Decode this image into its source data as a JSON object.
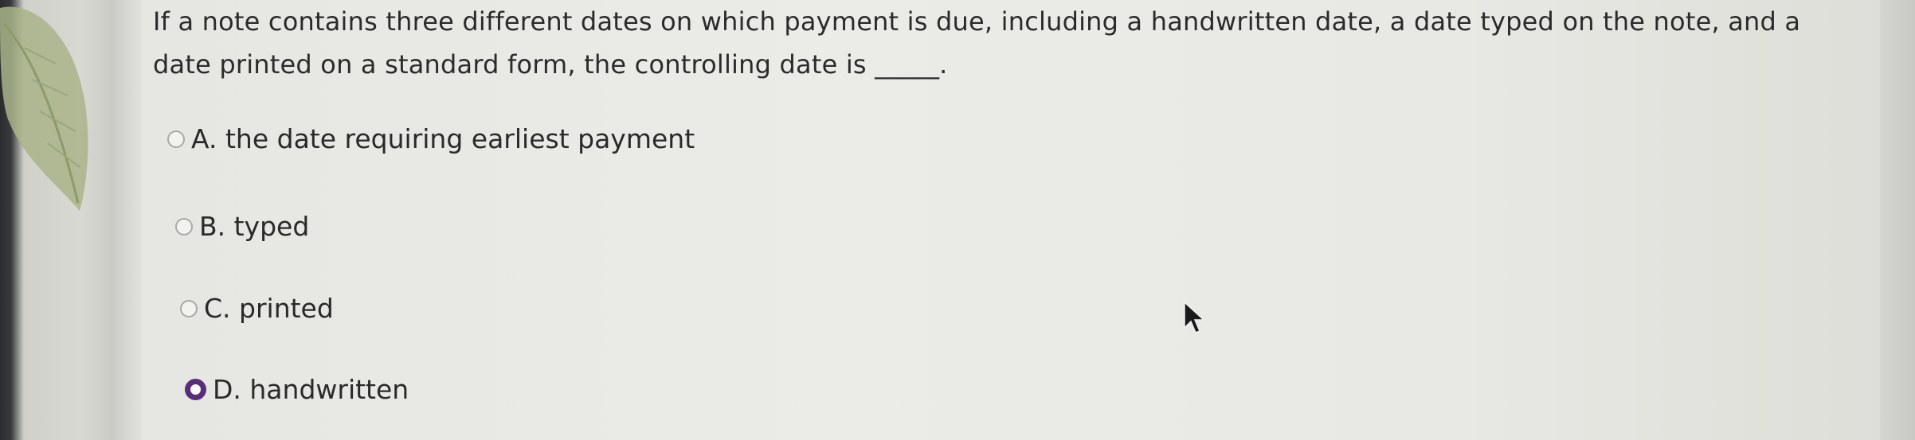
{
  "question": {
    "text": "If a note contains three different dates on which payment is due, including a handwritten date, a date typed on the note, and a date printed on a standard form, the controlling date is _____."
  },
  "options": [
    {
      "label": "A. the date requiring earliest payment",
      "selected": false
    },
    {
      "label": "B. typed",
      "selected": false
    },
    {
      "label": "C. printed",
      "selected": false
    },
    {
      "label": "D. handwritten",
      "selected": true
    }
  ],
  "colors": {
    "selected_radio": "#5a2d7a",
    "text": "#2b2b2b"
  }
}
